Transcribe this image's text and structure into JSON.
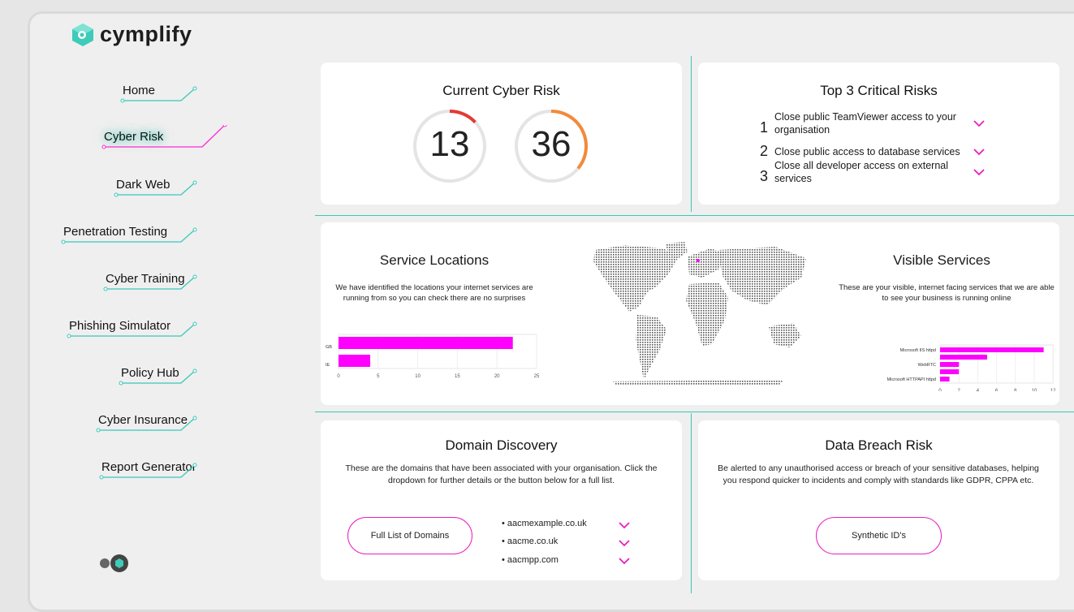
{
  "brand": {
    "name": "cymplify"
  },
  "sidebar": {
    "items": [
      {
        "label": "Home"
      },
      {
        "label": "Cyber Risk"
      },
      {
        "label": "Dark Web"
      },
      {
        "label": "Penetration Testing"
      },
      {
        "label": "Cyber Training"
      },
      {
        "label": "Phishing Simulator"
      },
      {
        "label": "Policy Hub"
      },
      {
        "label": "Cyber Insurance"
      },
      {
        "label": "Report Generator"
      }
    ],
    "active_index": 1
  },
  "current_risk": {
    "title": "Current Cyber Risk",
    "gauges": [
      {
        "value": "13",
        "fraction": 0.13,
        "color": "#e53935"
      },
      {
        "value": "36",
        "fraction": 0.36,
        "color": "#f28a3a"
      }
    ]
  },
  "top_risks": {
    "title": "Top 3 Critical Risks",
    "items": [
      {
        "num": "1",
        "text": "Close public TeamViewer access to your organisation"
      },
      {
        "num": "2",
        "text": "Close public access to database services"
      },
      {
        "num": "3",
        "text": "Close all developer access on external services"
      }
    ]
  },
  "service_locations": {
    "title": "Service Locations",
    "description": "We have identified the locations your internet services are running from so you can check there are no surprises"
  },
  "visible_services": {
    "title": "Visible Services",
    "description": "These are your visible, internet facing services that we are able to see your business is running online"
  },
  "domain_discovery": {
    "title": "Domain Discovery",
    "description": "These are the domains that have been associated with your organisation. Click the dropdown for further details or the button below for a full list.",
    "button": "Full List of Domains",
    "domains": [
      "• aacmexample.co.uk",
      "• aacme.co.uk",
      "• aacmpp.com"
    ]
  },
  "data_breach": {
    "title": "Data Breach Risk",
    "description": "Be alerted to any unauthorised access or breach of your sensitive databases, helping you respond quicker to incidents and comply with standards like GDPR, CPPA etc.",
    "button": "Synthetic ID's"
  },
  "colors": {
    "accent": "#39c8b8",
    "magenta": "#ff00ff",
    "pill": "#e81fbf"
  },
  "chart_data": [
    {
      "type": "bar",
      "orientation": "horizontal",
      "categories": [
        "GB",
        "IE"
      ],
      "values": [
        22,
        4
      ],
      "xlim": [
        0,
        25
      ],
      "xticks": [
        "0",
        "5",
        "10",
        "15",
        "20",
        "25"
      ],
      "color": "#ff00ff"
    },
    {
      "type": "bar",
      "orientation": "horizontal",
      "categories": [
        "Microsoft IIS httpd",
        "",
        "WebRTC",
        "",
        "Microsoft HTTPAPI httpd"
      ],
      "values": [
        11,
        5,
        2,
        2,
        1
      ],
      "xlim": [
        0,
        12
      ],
      "xticks": [
        "0",
        "2",
        "4",
        "6",
        "8",
        "10",
        "12"
      ],
      "color": "#ff00ff"
    }
  ]
}
